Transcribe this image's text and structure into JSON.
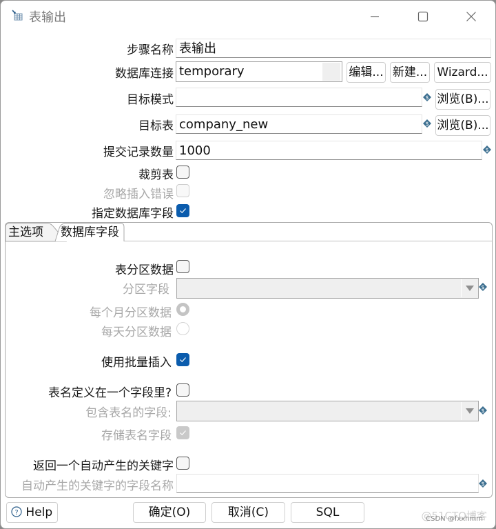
{
  "window": {
    "title": "表输出",
    "icon": "table-output-icon",
    "controls": {
      "minimize": "—",
      "maximize": "☐",
      "close": "✕"
    }
  },
  "form": {
    "step_name": {
      "label": "步骤名称",
      "value": "表输出"
    },
    "db_connection": {
      "label": "数据库连接",
      "value": "temporary",
      "edit_label": "编辑...",
      "new_label": "新建...",
      "wizard_label": "Wizard..."
    },
    "target_schema": {
      "label": "目标模式",
      "value": "",
      "browse_label": "浏览(B)..."
    },
    "target_table": {
      "label": "目标表",
      "value": "company_new",
      "browse_label": "浏览(B)..."
    },
    "commit_size": {
      "label": "提交记录数量",
      "value": "1000"
    },
    "truncate_table": {
      "label": "裁剪表",
      "checked": false
    },
    "ignore_insert_errors": {
      "label": "忽略插入错误",
      "checked": false,
      "disabled": true
    },
    "specify_db_fields": {
      "label": "指定数据库字段",
      "checked": true
    }
  },
  "tabs": [
    {
      "label": "主选项",
      "active": true
    },
    {
      "label": "数据库字段",
      "active": false
    }
  ],
  "main_options": {
    "partition_data": {
      "label": "表分区数据",
      "checked": false
    },
    "partition_field": {
      "label": "分区字段",
      "value": "",
      "disabled": true
    },
    "partition_monthly": {
      "label": "每个月分区数据",
      "selected": true,
      "disabled": true
    },
    "partition_daily": {
      "label": "每天分区数据",
      "selected": false,
      "disabled": true
    },
    "use_batch_insert": {
      "label": "使用批量插入",
      "checked": true
    },
    "table_name_in_field": {
      "label": "表名定义在一个字段里?",
      "checked": false
    },
    "table_name_field": {
      "label": "包含表名的字段:",
      "value": "",
      "disabled": true
    },
    "store_table_name_field": {
      "label": "存储表名字段",
      "checked": true,
      "disabled": true
    },
    "return_auto_key": {
      "label": "返回一个自动产生的关键字",
      "checked": false
    },
    "auto_key_field_name": {
      "label": "自动产生的关键字的字段名称",
      "value": "",
      "disabled": true
    }
  },
  "footer": {
    "help_label": "Help",
    "ok_label": "确定(O)",
    "cancel_label": "取消(C)",
    "sql_label": "SQL"
  },
  "watermark": {
    "text1": "@51CTO博客",
    "text2": "CSDN @fxxhmm"
  },
  "colors": {
    "accent": "#0b5cad",
    "variable_icon": "#3b6e8f"
  }
}
